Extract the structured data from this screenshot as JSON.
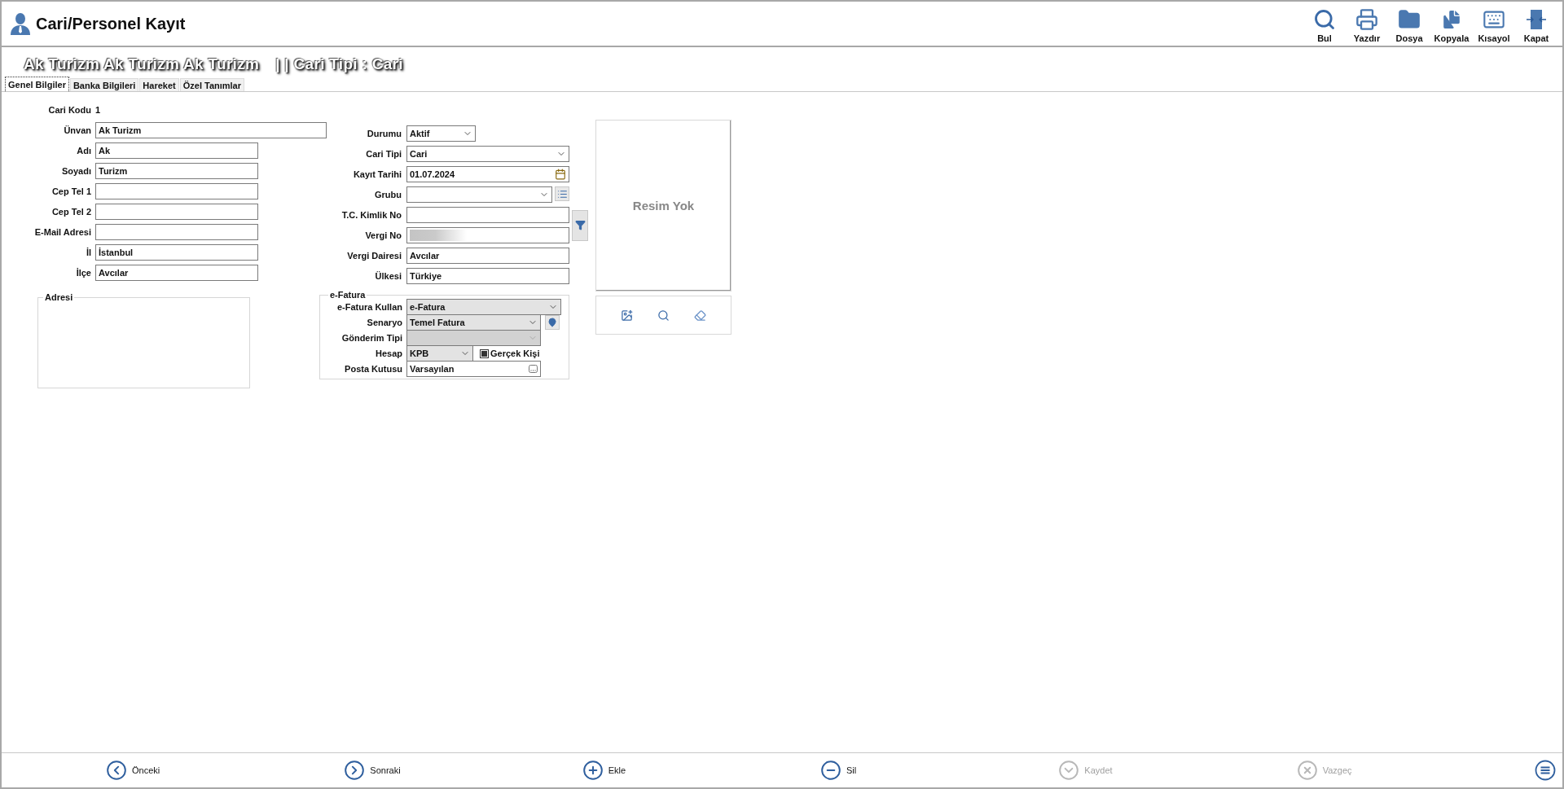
{
  "header": {
    "title": "Cari/Personel Kayıt"
  },
  "toolbar": [
    {
      "kind": "search",
      "label": "Bul"
    },
    {
      "kind": "print",
      "label": "Yazdır"
    },
    {
      "kind": "folder",
      "label": "Dosya"
    },
    {
      "kind": "copy",
      "label": "Kopyala"
    },
    {
      "kind": "keyboard",
      "label": "Kısayol"
    },
    {
      "kind": "close",
      "label": "Kapat"
    }
  ],
  "record_title": {
    "name": "Ak Turizm Ak Turizm Ak Turizm",
    "type_text": "| | Cari Tipi : Cari"
  },
  "tabs": [
    {
      "label": "Genel Bilgiler",
      "selected": true
    },
    {
      "label": "Banka Bilgileri",
      "selected": false
    },
    {
      "label": "Hareket",
      "selected": false
    },
    {
      "label": "Özel Tanımlar",
      "selected": false
    }
  ],
  "cari_kodu": {
    "label": "Cari Kodu",
    "value": "1"
  },
  "left_fields": [
    {
      "label": "Ünvan",
      "value": "Ak Turizm",
      "kind": "wide"
    },
    {
      "label": "Adı",
      "value": "Ak",
      "kind": "text"
    },
    {
      "label": "Soyadı",
      "value": "Turizm",
      "kind": "text"
    },
    {
      "label": "Cep Tel 1",
      "kind": "text"
    },
    {
      "label": "Cep Tel 2",
      "kind": "text"
    },
    {
      "label": "E-Mail Adresi",
      "kind": "text"
    },
    {
      "label": "İl",
      "value": "İstanbul",
      "kind": "text"
    },
    {
      "label": "İlçe",
      "value": "Avcılar",
      "kind": "text"
    }
  ],
  "right_fields": [
    {
      "label": "Durumu",
      "value": "Aktif",
      "kind": "short-select"
    },
    {
      "label": "Cari Tipi",
      "value": "Cari",
      "kind": "select"
    },
    {
      "label": "Kayıt Tarihi",
      "value": "01.07.2024",
      "kind": "date"
    },
    {
      "label": "Grubu",
      "kind": "select-list"
    },
    {
      "label": "T.C. Kimlik No",
      "kind": "filter-text"
    },
    {
      "label": "Vergi No",
      "kind": "redacted"
    },
    {
      "label": "Vergi Dairesi",
      "value": "Avcılar",
      "kind": "text"
    },
    {
      "label": "Ülkesi",
      "value": "Türkiye",
      "kind": "text"
    }
  ],
  "address": {
    "label": "Adresi"
  },
  "efatura": {
    "title": "e-Fatura",
    "fields": [
      {
        "label": "e-Fatura Kullan",
        "value": "e-Fatura",
        "kind": "select",
        "readonly": true,
        "disabled": false
      },
      {
        "label": "Senaryo",
        "value": "Temel Fatura",
        "kind": "select-pin",
        "readonly": true,
        "disabled": false
      },
      {
        "label": "Gönderim Tipi",
        "kind": "select-narrow",
        "readonly": false,
        "disabled": true
      },
      {
        "label": "Hesap",
        "value": "KPB",
        "kind": "select-check",
        "readonly": true,
        "disabled": false,
        "check_label": "Gerçek Kişi",
        "checked": true
      },
      {
        "label": "Posta Kutusu",
        "value": "Varsayılan",
        "kind": "ellipsis",
        "readonly": false,
        "disabled": false
      }
    ]
  },
  "picture": {
    "placeholder": "Resim Yok"
  },
  "nav": [
    {
      "kind": "previous",
      "label": "Önceki",
      "disabled": false
    },
    {
      "kind": "next",
      "label": "Sonraki",
      "disabled": false
    },
    {
      "kind": "add",
      "label": "Ekle",
      "disabled": false
    },
    {
      "kind": "delete",
      "label": "Sil",
      "disabled": false
    },
    {
      "kind": "save",
      "label": "Kaydet",
      "disabled": true
    },
    {
      "kind": "cancel",
      "label": "Vazgeç",
      "disabled": true
    }
  ]
}
